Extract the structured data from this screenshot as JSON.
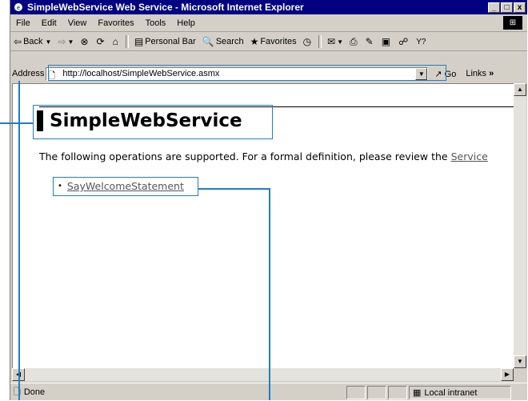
{
  "window": {
    "title": "SimpleWebService Web Service - Microsoft Internet Explorer",
    "buttons": {
      "minimize": "_",
      "maximize": "□",
      "close": "x"
    }
  },
  "menu": [
    "File",
    "Edit",
    "View",
    "Favorites",
    "Tools",
    "Help"
  ],
  "toolbar": {
    "back": "Back",
    "forward": "",
    "personal_bar": "Personal Bar",
    "search": "Search",
    "favorites": "Favorites"
  },
  "address": {
    "label": "Address",
    "url": "http://localhost/SimpleWebService.asmx",
    "go": "Go",
    "links": "Links"
  },
  "page": {
    "heading": "SimpleWebService",
    "description": "The following operations are supported. For a formal definition, please review the ",
    "description_link": "Service",
    "operations": [
      "SayWelcomeStatement"
    ]
  },
  "status": {
    "text": "Done",
    "zone": "Local intranet"
  },
  "colors": {
    "title_bar": "#000080",
    "callout": "#1e7fc4",
    "chrome": "#d4d0c8"
  },
  "icons": [
    "ie-icon",
    "back-arrow-icon",
    "forward-arrow-icon",
    "stop-icon",
    "refresh-icon",
    "home-icon",
    "search-icon",
    "favorites-icon",
    "history-icon",
    "mail-icon",
    "print-icon",
    "edit-icon",
    "discuss-icon",
    "messenger-icon",
    "page-icon",
    "go-arrow-icon"
  ]
}
